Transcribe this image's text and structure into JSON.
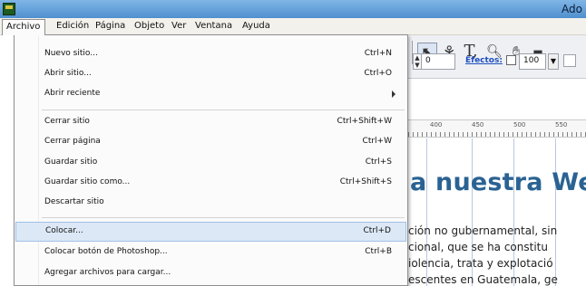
{
  "window": {
    "title": "Ado"
  },
  "menubar": {
    "items": [
      "Archivo",
      "Edición",
      "Página",
      "Objeto",
      "Ver",
      "Ventana",
      "Ayuda"
    ],
    "active": "Archivo"
  },
  "toolbar": {
    "field_value": "0",
    "efectos_label": "Efectos:",
    "efectos_value": "100",
    "tool_text_glyph": "T,"
  },
  "ruler": {
    "labels": [
      "400",
      "450",
      "500",
      "550"
    ]
  },
  "document": {
    "heading": "a nuestra We",
    "lines": [
      "ción no gubernamental, sin",
      "cional, que se ha constitu",
      "iolencia, trata y explotació",
      "escentes en Guatemala, ge"
    ]
  },
  "archivo_menu": {
    "items": [
      {
        "label": "Nuevo sitio...",
        "shortcut": "Ctrl+N"
      },
      {
        "label": "Abrir sitio...",
        "shortcut": "Ctrl+O"
      },
      {
        "label": "Abrir reciente",
        "shortcut": "",
        "submenu": true
      },
      {
        "label": "Cerrar sitio",
        "shortcut": "Ctrl+Shift+W"
      },
      {
        "label": "Cerrar página",
        "shortcut": "Ctrl+W"
      },
      {
        "label": "Guardar sitio",
        "shortcut": "Ctrl+S"
      },
      {
        "label": "Guardar sitio como...",
        "shortcut": "Ctrl+Shift+S"
      },
      {
        "label": "Descartar sitio",
        "shortcut": ""
      },
      {
        "label": "Colocar...",
        "shortcut": "Ctrl+D",
        "highlighted": true
      },
      {
        "label": "Colocar botón de Photoshop...",
        "shortcut": "Ctrl+B"
      },
      {
        "label": "Agregar archivos para cargar...",
        "shortcut": ""
      }
    ]
  },
  "colors": {
    "title_bar": "#4f8fcf",
    "highlight": "#dce8f6",
    "heading": "#2a6293",
    "link": "#1d4fbf"
  }
}
